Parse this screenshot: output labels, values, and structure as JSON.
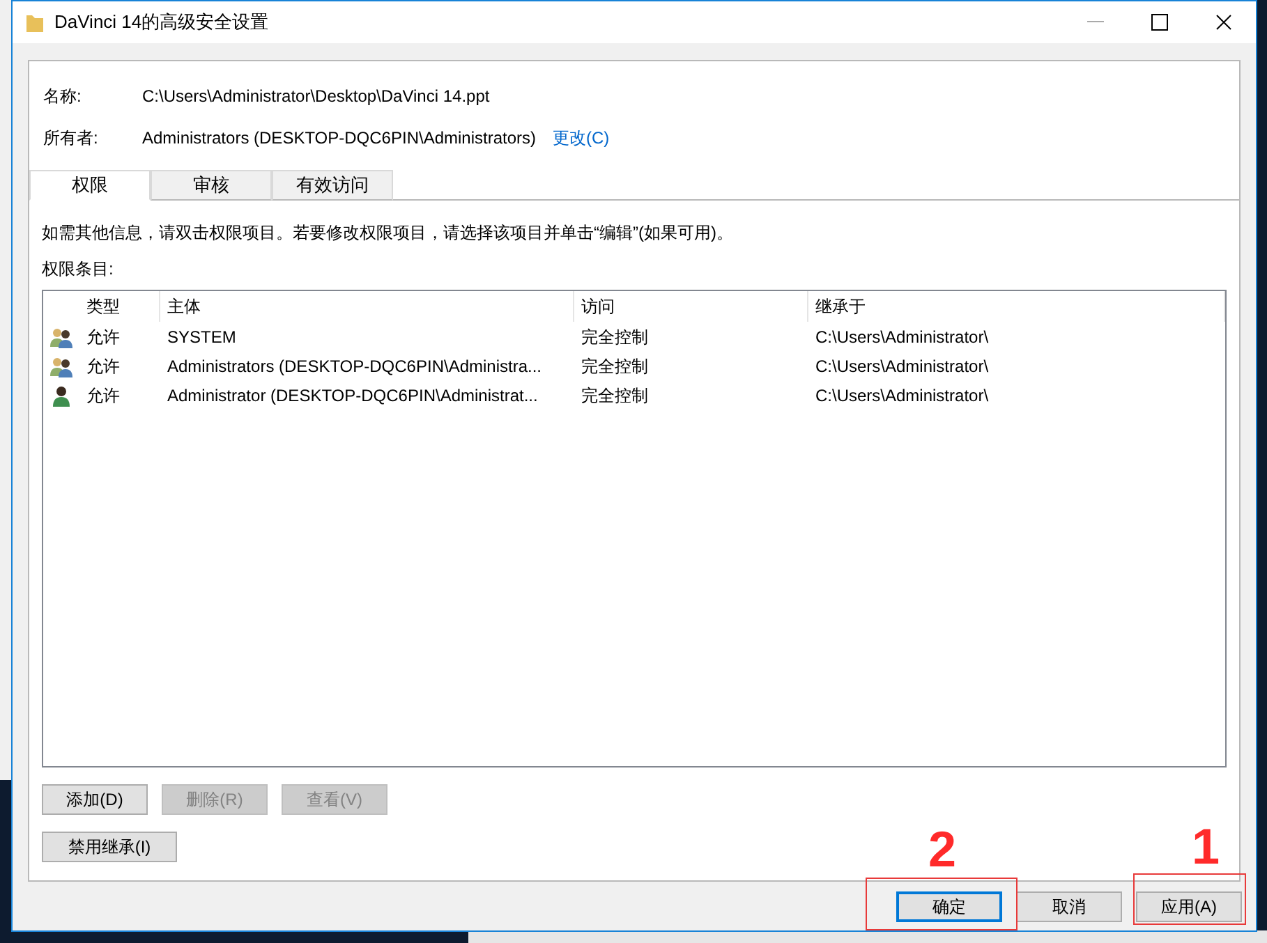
{
  "window": {
    "title": "DaVinci 14的高级安全设置"
  },
  "info": {
    "name_label": "名称:",
    "name_value": "C:\\Users\\Administrator\\Desktop\\DaVinci 14.ppt",
    "owner_label": "所有者:",
    "owner_value": "Administrators (DESKTOP-DQC6PIN\\Administrators)",
    "change_link": "更改(C)"
  },
  "tabs": [
    {
      "label": "权限",
      "selected": true
    },
    {
      "label": "审核",
      "selected": false
    },
    {
      "label": "有效访问",
      "selected": false
    }
  ],
  "instruction": "如需其他信息，请双击权限项目。若要修改权限项目，请选择该项目并单击“编辑”(如果可用)。",
  "entries_label": "权限条目:",
  "table": {
    "columns": [
      "类型",
      "主体",
      "访问",
      "继承于"
    ],
    "rows": [
      {
        "kind": "group",
        "type": "允许",
        "principal": "SYSTEM",
        "access": "完全控制",
        "inherited_from": "C:\\Users\\Administrator\\"
      },
      {
        "kind": "group",
        "type": "允许",
        "principal": "Administrators (DESKTOP-DQC6PIN\\Administra...",
        "access": "完全控制",
        "inherited_from": "C:\\Users\\Administrator\\"
      },
      {
        "kind": "user",
        "type": "允许",
        "principal": "Administrator (DESKTOP-DQC6PIN\\Administrat...",
        "access": "完全控制",
        "inherited_from": "C:\\Users\\Administrator\\"
      }
    ]
  },
  "entry_buttons": [
    {
      "label": "添加(D)",
      "disabled": false
    },
    {
      "label": "删除(R)",
      "disabled": true
    },
    {
      "label": "查看(V)",
      "disabled": true
    }
  ],
  "inheritance_button": "禁用继承(I)",
  "dialog_buttons": [
    {
      "label": "确定",
      "default": true
    },
    {
      "label": "取消",
      "default": false
    },
    {
      "label": "应用(A)",
      "default": false
    }
  ],
  "annotations": [
    {
      "label": "2"
    },
    {
      "label": "1"
    }
  ]
}
